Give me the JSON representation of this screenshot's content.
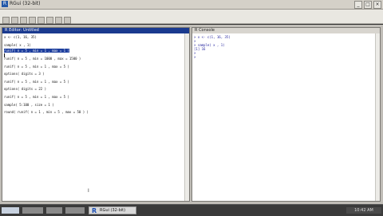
{
  "window": {
    "title": "RGui (32-bit)",
    "minimize": "_",
    "maximize": "□",
    "close": "×",
    "icon": "R"
  },
  "toolbar": {
    "icons": [
      "open-icon",
      "load-icon",
      "save-icon",
      "copy-icon",
      "paste-icon",
      "copy-paste-icon",
      "stop-icon",
      "print-icon"
    ]
  },
  "editor": {
    "title": "R Editor: Untitled",
    "lines": [
      "x <- c(1, 16, 35)",
      "",
      "sample( x , 1)",
      "",
      "runif( n = 5 , min = 1 , max = 1 )",
      "",
      "runif( n = 5 , min = 1000 , max = 1500 )",
      "",
      "runif( n = 5 , min = 1 , max = 5 )",
      "",
      "options( digits = 3 )",
      "",
      "runif( n = 5 , min = 1 , max = 5 )",
      "",
      "options( digits = 22 )",
      "",
      "runif( n = 5 , min = 1 , max = 5 )",
      "",
      "sample( 5:100 , size = 1 )",
      "",
      "round( runif( n = 1 , min = 5 , max = 50 ) )"
    ]
  },
  "console": {
    "title": "R Console",
    "lines": [
      "> x <- c(1, 16, 35)",
      ">",
      "> sample( x , 1)",
      "[1] 16",
      ">",
      ">"
    ]
  },
  "taskbar": {
    "r_logo": "R",
    "r_label": "RGui (32-bit)",
    "tray": "10:42 AM"
  }
}
